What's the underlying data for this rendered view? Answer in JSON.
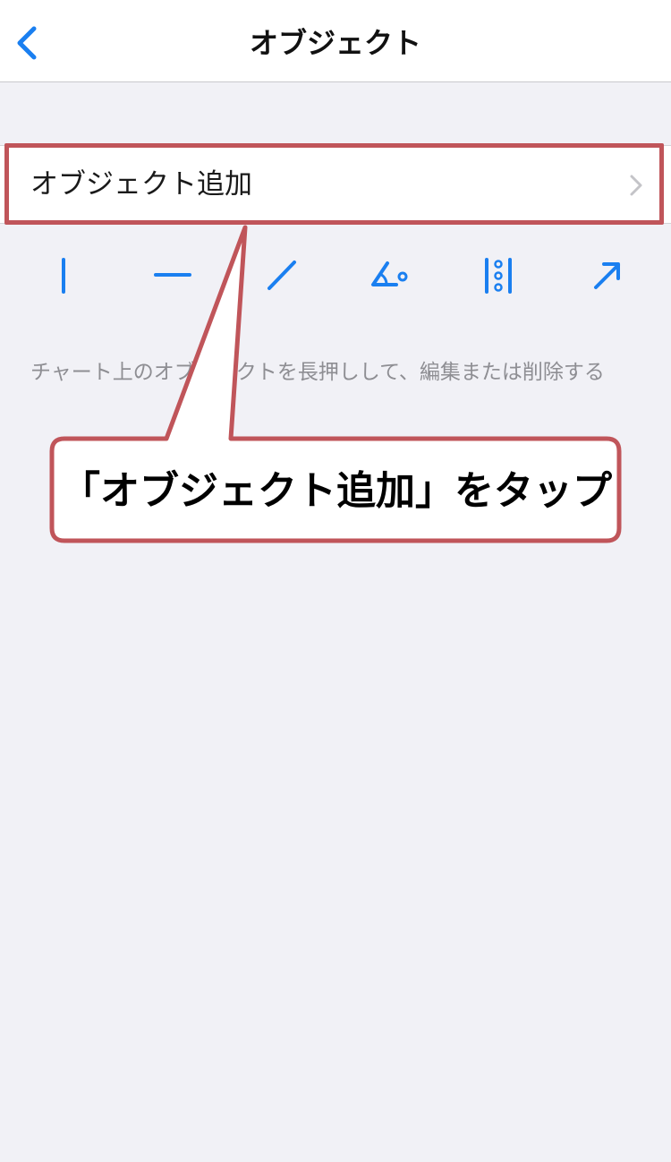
{
  "navbar": {
    "title": "オブジェクト",
    "back_icon": "chevron-left-icon"
  },
  "add_object_row": {
    "label": "オブジェクト追加",
    "chevron_icon": "chevron-right-icon"
  },
  "tools": [
    {
      "name": "vertical-line-icon"
    },
    {
      "name": "horizontal-line-icon"
    },
    {
      "name": "trend-line-icon"
    },
    {
      "name": "angle-icon"
    },
    {
      "name": "vertical-dots-icon"
    },
    {
      "name": "arrow-icon"
    }
  ],
  "hint": "チャート上のオブジェクトを長押しして、編集または削除する",
  "callout": {
    "text": "「オブジェクト追加」をタップ"
  },
  "colors": {
    "accent": "#1a7ff0",
    "highlight": "#c0555a",
    "background": "#f1f1f6"
  }
}
